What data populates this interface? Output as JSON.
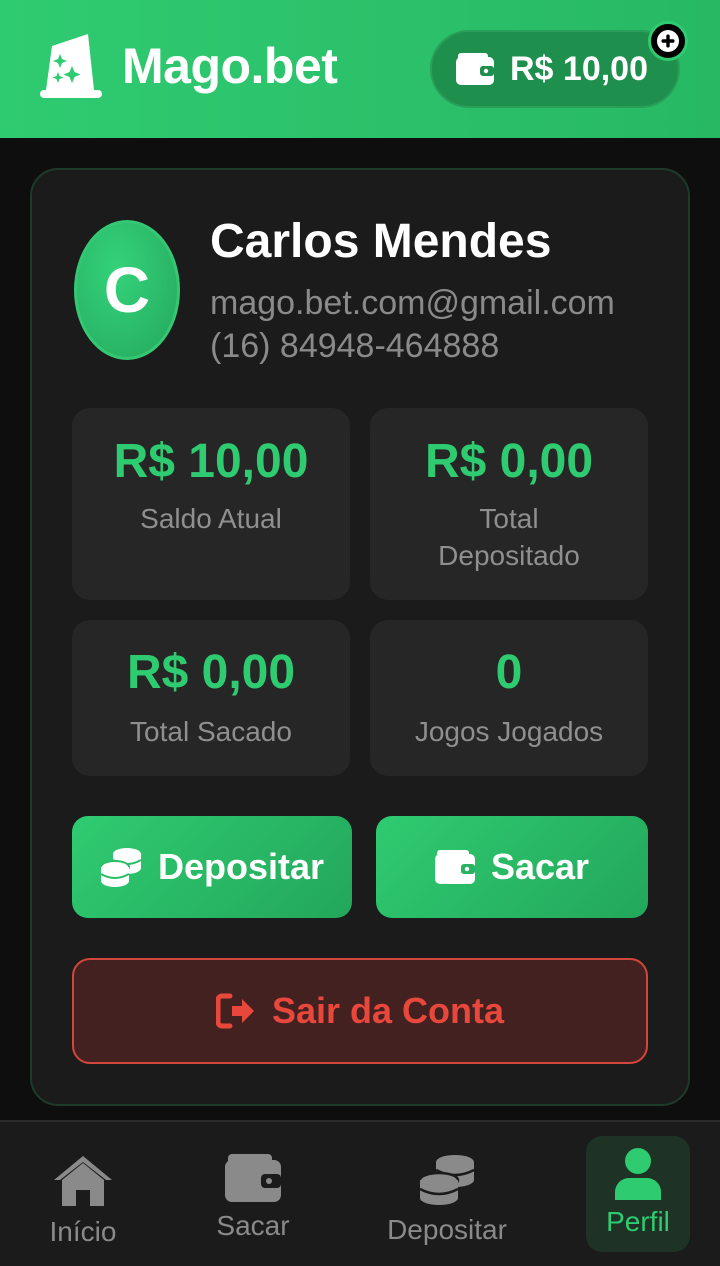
{
  "header": {
    "brand": "Mago.bet",
    "balance": "R$ 10,00",
    "logo_icon": "wizard-hat-icon",
    "wallet_icon": "wallet-icon",
    "add_icon": "plus-icon"
  },
  "profile": {
    "avatar_letter": "C",
    "name": "Carlos Mendes",
    "email": "mago.bet.com@gmail.com",
    "phone": "(16) 84948-464888"
  },
  "stats": [
    {
      "value": "R$ 10,00",
      "label": "Saldo Atual"
    },
    {
      "value": "R$ 0,00",
      "label": "Total Depositado"
    },
    {
      "value": "R$ 0,00",
      "label": "Total Sacado"
    },
    {
      "value": "0",
      "label": "Jogos Jogados"
    }
  ],
  "actions": {
    "deposit_label": "Depositar",
    "withdraw_label": "Sacar",
    "logout_label": "Sair da Conta"
  },
  "bottom_nav": [
    {
      "label": "Início",
      "icon": "home-icon",
      "active": false
    },
    {
      "label": "Sacar",
      "icon": "wallet-icon",
      "active": false
    },
    {
      "label": "Depositar",
      "icon": "coins-icon",
      "active": false
    },
    {
      "label": "Perfil",
      "icon": "user-icon",
      "active": true
    }
  ],
  "colors": {
    "brand_green": "#2fcb71",
    "danger_red": "#e8473c",
    "background": "#0e0e0e",
    "card": "#1b1b1b"
  }
}
